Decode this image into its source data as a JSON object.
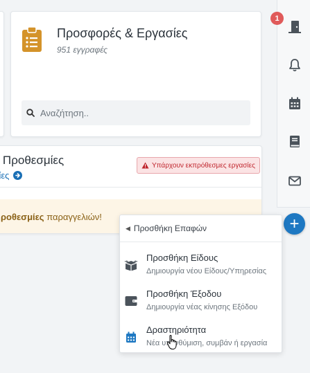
{
  "notifications": {
    "count": "1"
  },
  "offers_card": {
    "title": "Προσφορές & Εργασίες",
    "subtitle": "951 εγγραφές",
    "search_placeholder": "Αναζήτηση.."
  },
  "deadlines_card": {
    "title": "ς Προθεσμίες",
    "link_label": "μίες",
    "warning_badge": "Υπάρχουν εκπρόθεσμες εργασίες",
    "notice_bold": "ροθεσμίες",
    "notice_rest": " παραγγελιών!"
  },
  "colors": {
    "accent": "#1e78c2",
    "warning": "#c0262e",
    "clipboard": "#d4932a"
  },
  "right_bar": {
    "icons": [
      "exit-door-icon",
      "bell-icon",
      "calendar-icon",
      "book-icon",
      "envelope-icon"
    ]
  },
  "fab": {
    "label": "+"
  },
  "add_menu": {
    "header": "Προσθήκη Επαφών",
    "items": [
      {
        "icon": "box-icon",
        "title": "Προσθήκη Είδους",
        "subtitle": "Δημιουργία νέου Είδους/Υπηρεσίας"
      },
      {
        "icon": "wallet-icon",
        "title": "Προσθήκη Έξοδου",
        "subtitle": "Δημιουργία νέας κίνησης Εξόδου"
      },
      {
        "icon": "calendar-icon",
        "title": "Δραστηριότητα",
        "subtitle": "Νέα υπενθύμιση, συμβάν ή εργασία"
      }
    ]
  }
}
